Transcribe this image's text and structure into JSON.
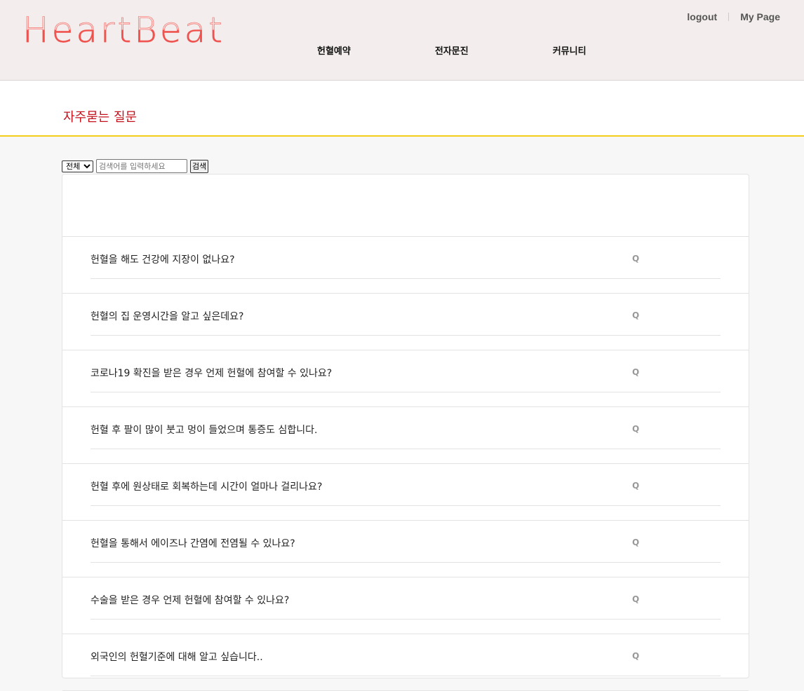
{
  "header": {
    "logo": "HeartBeat",
    "top_links": [
      "logout",
      "My Page"
    ],
    "nav": [
      "헌혈예약",
      "전자문진",
      "커뮤니티"
    ]
  },
  "page": {
    "title": "자주묻는 질문"
  },
  "search": {
    "category_selected": "전체",
    "placeholder": "검색어를 입력하세요",
    "button_label": "검색"
  },
  "faq": {
    "marker": "Q",
    "items": [
      "헌혈을 해도 건강에 지장이 없나요?",
      "헌혈의 집 운영시간을 알고 싶은데요?",
      "코로나19 확진을 받은 경우 언제 헌혈에 참여할 수 있나요?",
      "헌혈 후 팔이 많이 붓고 멍이 들었으며 통증도 심합니다.",
      "헌혈 후에 원상태로 회복하는데 시간이 얼마나 걸리나요?",
      "헌혈을 통해서 에이즈나 간염에 전염될 수 있나요?",
      "수술을 받은 경우 언제 헌혈에 참여할 수 있나요?",
      "외국인의 헌혈기준에 대해 알고 싶습니다.."
    ]
  },
  "colors": {
    "header_bg": "#f3eeed",
    "title_red": "#c4121d",
    "accent_yellow": "#f5ce1b",
    "logo_red": "#ee4c49"
  }
}
